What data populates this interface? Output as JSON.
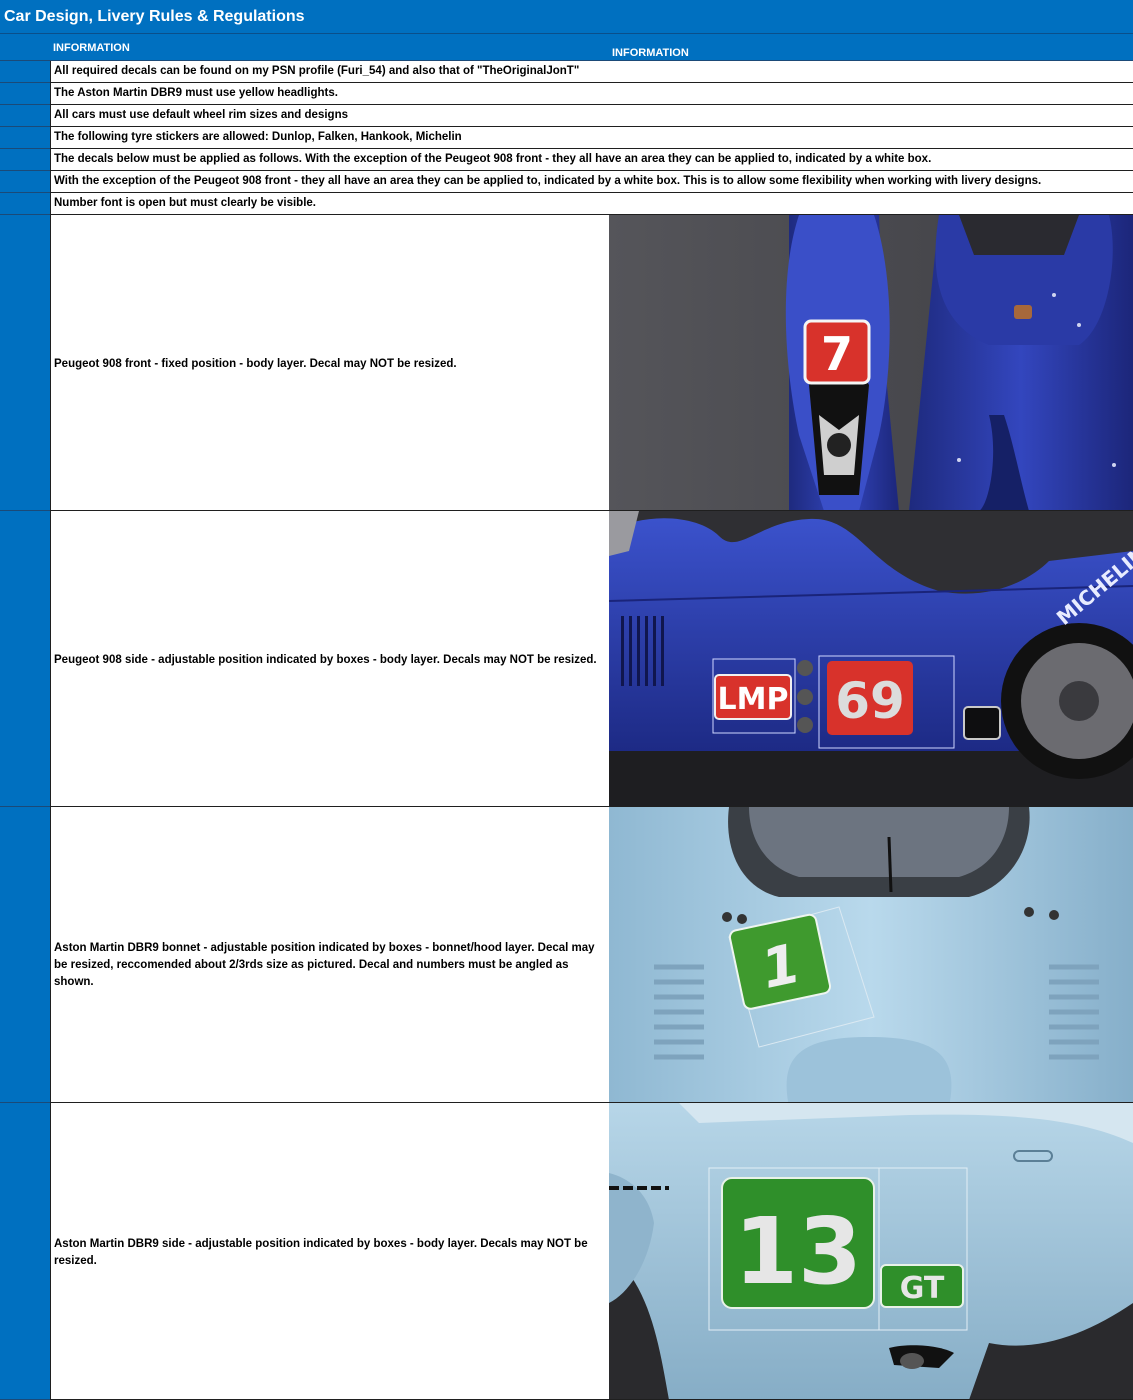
{
  "title": "Car Design, Livery Rules & Regulations",
  "header": {
    "col_a": "INFORMATION",
    "col_b": "INFORMATION"
  },
  "rules": [
    "All required decals can be found on my PSN profile (Furi_54) and also that of \"TheOriginalJonT\"",
    "The Aston Martin DBR9 must use yellow headlights.",
    "All cars must use default wheel rim sizes and designs",
    "The following tyre stickers are allowed: Dunlop, Falken, Hankook, Michelin",
    "The decals below must be applied as follows. With the exception of the Peugeot 908 front - they all have an area they can be applied to, indicated by a white box.",
    "With the exception of the Peugeot 908 front - they all have an area they can be applied to, indicated by a white box. This is to allow some flexibility when working with livery designs.",
    "Number font is open but must clearly be visible."
  ],
  "decals": [
    {
      "text": "Peugeot 908 front - fixed position - body layer. Decal may NOT be resized.",
      "image": {
        "number": "7",
        "colors": {
          "body": "#2b3aa6",
          "plate": "#d8322b"
        }
      }
    },
    {
      "text": "Peugeot 908 side - adjustable position indicated by boxes - body layer. Decals may NOT be resized.",
      "image": {
        "class_label": "LMP",
        "number": "69",
        "tyre_text": "MICHELIN",
        "colors": {
          "body": "#2c3fae",
          "plate": "#d8322b"
        }
      }
    },
    {
      "text": "Aston Martin DBR9 bonnet - adjustable position indicated by boxes - bonnet/hood layer. Decal may be resized, reccomended about 2/3rds size as pictured. Decal and numbers must be angled as shown.",
      "image": {
        "number": "1",
        "colors": {
          "body": "#a9cfe6",
          "plate": "#3f9a2e"
        }
      }
    },
    {
      "text": "Aston Martin DBR9 side - adjustable position indicated by boxes - body layer. Decals may NOT be resized.",
      "image": {
        "number": "13",
        "class_label": "GT",
        "colors": {
          "body": "#9ec6dd",
          "plate": "#2f8f2a"
        }
      }
    }
  ],
  "colors": {
    "accent": "#0070c0"
  }
}
